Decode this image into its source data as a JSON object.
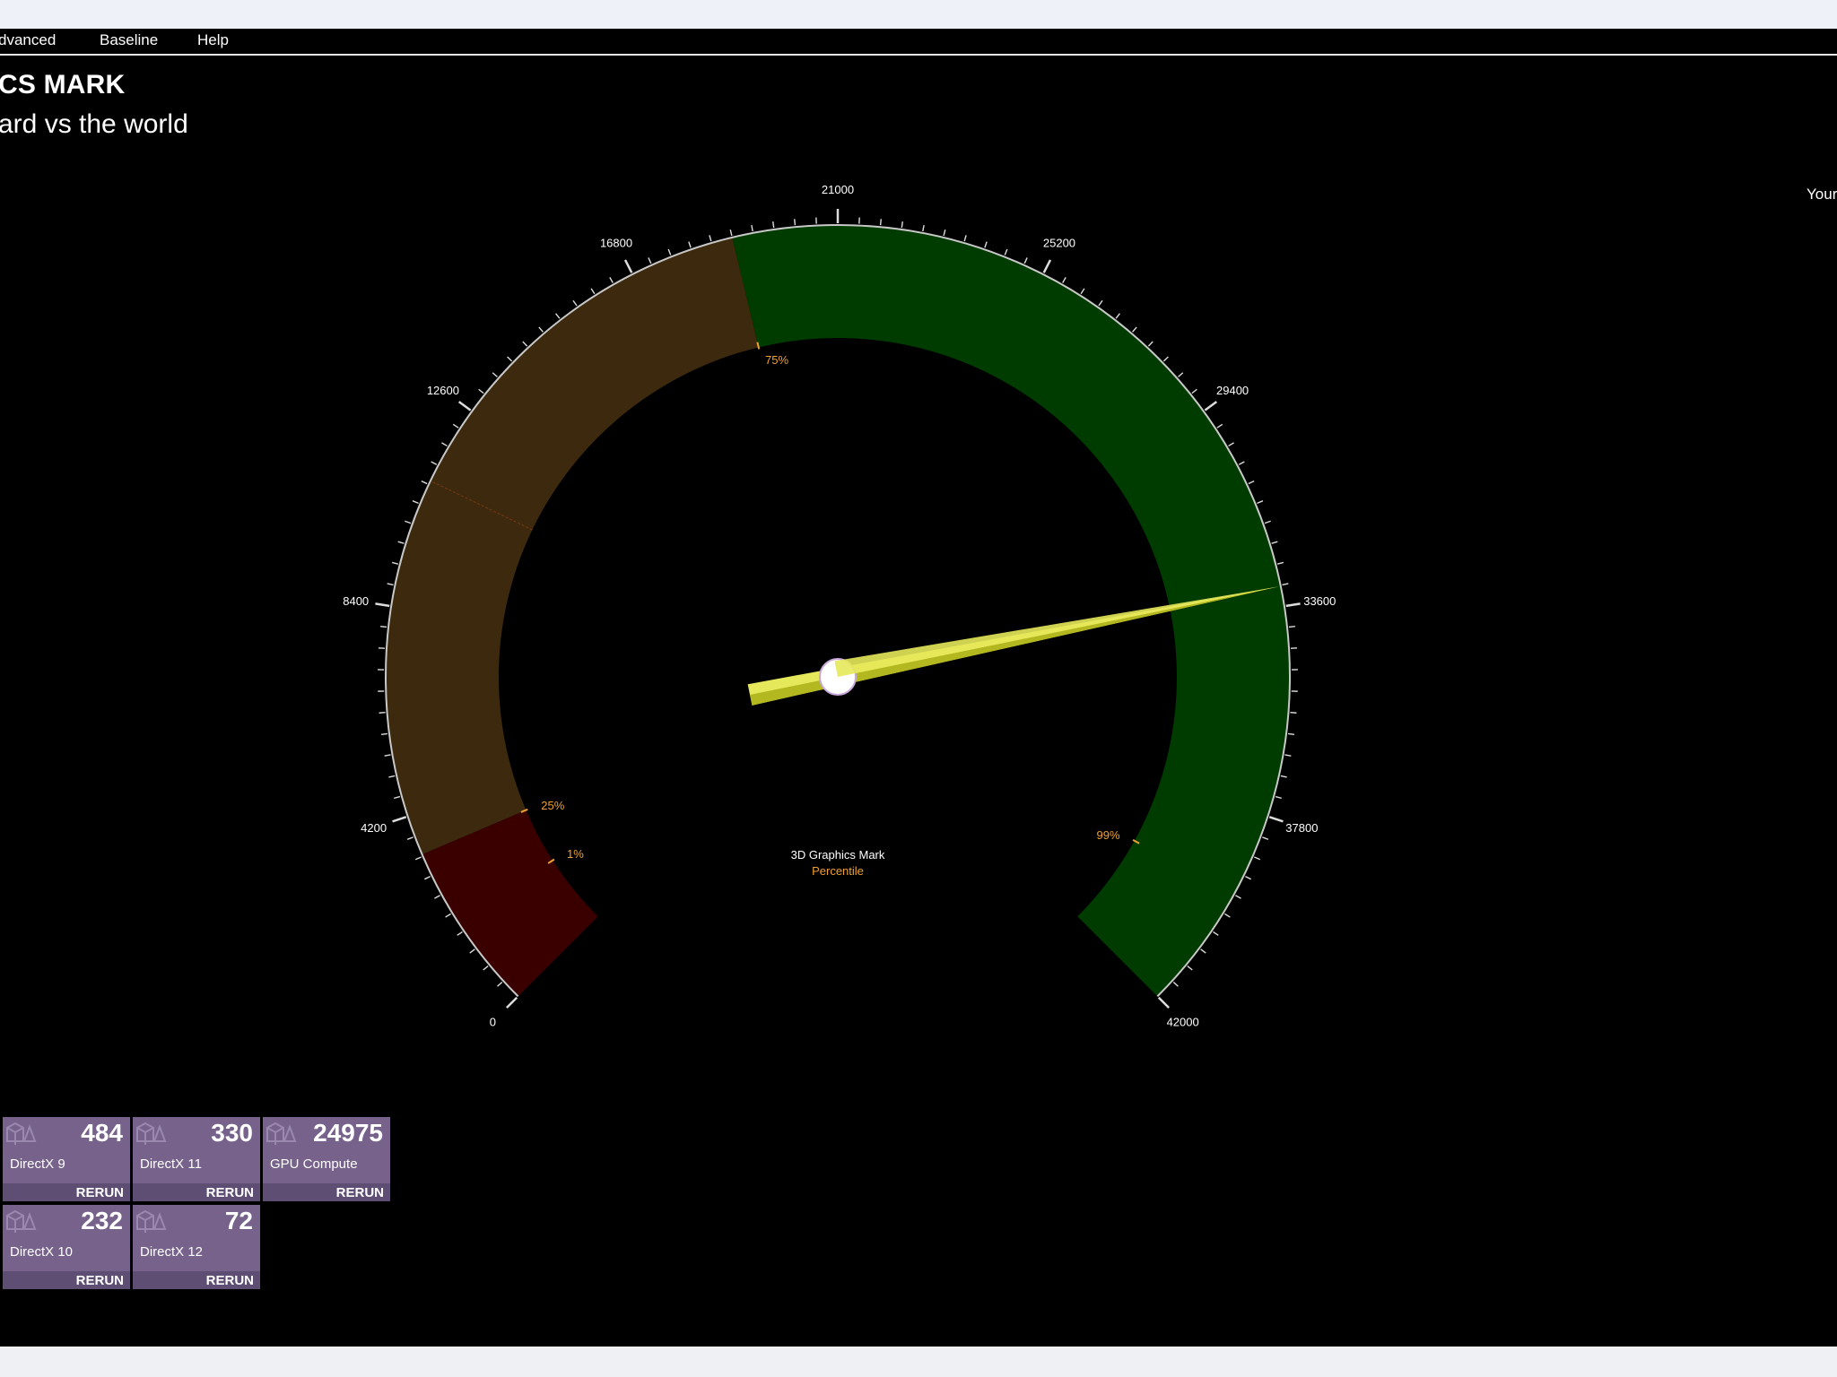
{
  "menu": {
    "items": [
      "dvanced",
      "Baseline",
      "Help"
    ]
  },
  "header": {
    "title": "CS MARK",
    "subtitle": "ard vs the world"
  },
  "right_label": "Your",
  "gauge": {
    "min": 0,
    "max": 42000,
    "value": 33200,
    "tick_labels": [
      "0",
      "4200",
      "8400",
      "12600",
      "16800",
      "21000",
      "25200",
      "29400",
      "33600",
      "37800",
      "42000"
    ],
    "percentile_markers": [
      {
        "label": "1%",
        "value": 1900
      },
      {
        "label": "25%",
        "value": 3400
      },
      {
        "label": "75%",
        "value": 18900
      },
      {
        "label": "99%",
        "value": 39500
      }
    ],
    "bands": [
      {
        "from": 0,
        "to": 3400,
        "color": "#3a0000"
      },
      {
        "from": 3400,
        "to": 18900,
        "color": "#3d2a0e"
      },
      {
        "from": 18900,
        "to": 42000,
        "color": "#003b00"
      }
    ],
    "center_label": "3D Graphics Mark",
    "center_sublabel": "Percentile",
    "needle_color": "#e5e85a",
    "marker_color": "#f0a030"
  },
  "tiles": [
    {
      "score": "484",
      "label": "DirectX 9",
      "action": "RERUN"
    },
    {
      "score": "330",
      "label": "DirectX 11",
      "action": "RERUN"
    },
    {
      "score": "24975",
      "label": "GPU Compute",
      "action": "RERUN"
    },
    {
      "score": "232",
      "label": "DirectX 10",
      "action": "RERUN"
    },
    {
      "score": "72",
      "label": "DirectX 12",
      "action": "RERUN"
    }
  ]
}
